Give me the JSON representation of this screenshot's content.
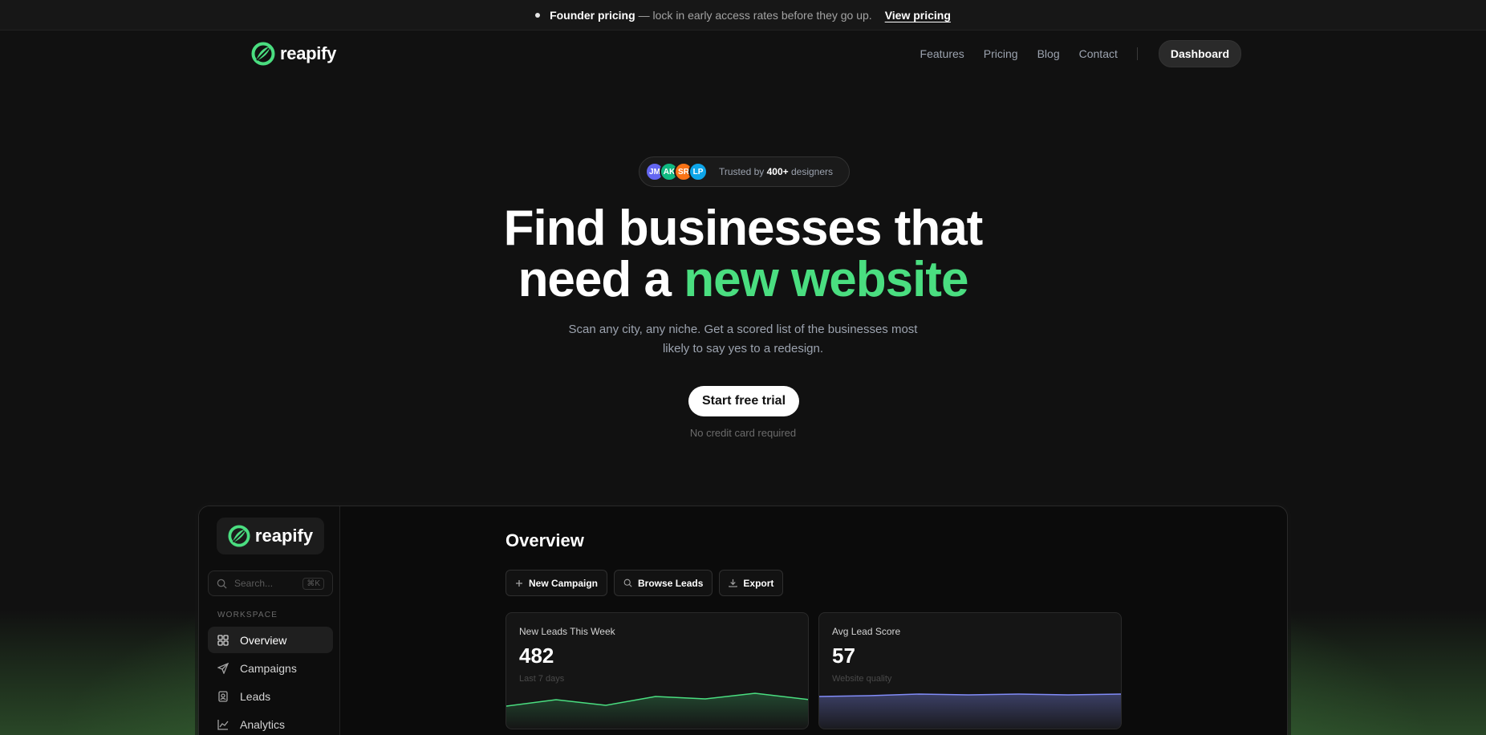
{
  "announcement": {
    "strong": "Founder pricing",
    "text": "— lock in early access rates before they go up.",
    "link": "View pricing"
  },
  "brand": {
    "name": "reapify",
    "accent": "#4ade80"
  },
  "nav": {
    "links": [
      "Features",
      "Pricing",
      "Blog",
      "Contact"
    ],
    "dashboard": "Dashboard"
  },
  "trust": {
    "avatars": [
      {
        "initials": "JM",
        "color": "#6366f1"
      },
      {
        "initials": "AK",
        "color": "#10b981"
      },
      {
        "initials": "SR",
        "color": "#f97316"
      },
      {
        "initials": "LP",
        "color": "#0ea5e9"
      }
    ],
    "prefix": "Trusted by",
    "count": "400+",
    "suffix": "designers"
  },
  "hero": {
    "line1": "Find businesses that",
    "line2_plain": "need a",
    "line2_accent": "new website",
    "sub1": "Scan any city, any niche. Get a scored list of the businesses most",
    "sub2": "likely to say yes to a redesign.",
    "cta": "Start free trial",
    "note": "No credit card required"
  },
  "app": {
    "brand": "reapify",
    "search_placeholder": "Search...",
    "search_shortcut": "⌘K",
    "section": "WORKSPACE",
    "nav": [
      {
        "label": "Overview",
        "icon": "grid-icon",
        "active": true
      },
      {
        "label": "Campaigns",
        "icon": "send-icon",
        "active": false
      },
      {
        "label": "Leads",
        "icon": "contact-icon",
        "active": false
      },
      {
        "label": "Analytics",
        "icon": "chart-icon",
        "active": false
      }
    ],
    "title": "Overview",
    "actions": [
      {
        "label": "New Campaign",
        "icon": "plus-icon"
      },
      {
        "label": "Browse Leads",
        "icon": "search-icon"
      },
      {
        "label": "Export",
        "icon": "download-icon"
      }
    ],
    "cards": [
      {
        "title": "New Leads This Week",
        "value": "482",
        "sub": "Last 7 days",
        "color": "#4ade80"
      },
      {
        "title": "Avg Lead Score",
        "value": "57",
        "sub": "Website quality",
        "color": "#818cf8"
      }
    ]
  }
}
